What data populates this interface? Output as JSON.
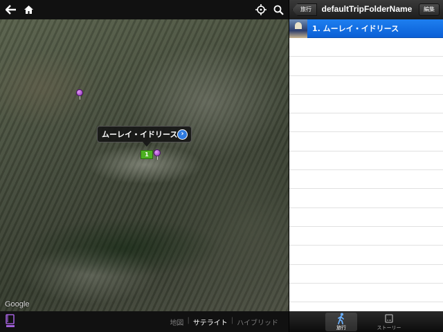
{
  "map": {
    "callout_title": "ムーレイ・イドリース",
    "marker_label": "1",
    "google_logo": "Google",
    "map_types": [
      {
        "label": "地図",
        "selected": false
      },
      {
        "label": "サテライト",
        "selected": true
      },
      {
        "label": "ハイブリッド",
        "selected": false
      }
    ]
  },
  "list": {
    "back_label": "旅行",
    "title": "defaultTripFolderName",
    "edit_label": "編集",
    "selected_item": "1. ムーレイ・イドリース"
  },
  "tabs": [
    {
      "label": "旅行",
      "icon": "walker-icon",
      "active": true
    },
    {
      "label": "ストーリー",
      "icon": "story-icon",
      "active": false
    }
  ],
  "colors": {
    "selection_blue": "#0a5fd6",
    "marker_green": "#4cb021",
    "pin_purple": "#8a2bb5",
    "book_icon_purple": "#a05fd8"
  }
}
